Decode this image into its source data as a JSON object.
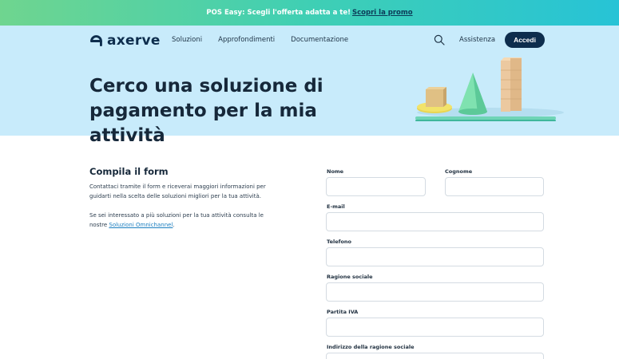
{
  "promo": {
    "text": "POS Easy: Scegli l'offerta adatta a te!",
    "link": "Scopri la promo"
  },
  "header": {
    "logo": "axerve",
    "nav": [
      "Soluzioni",
      "Approfondimenti",
      "Documentazione"
    ],
    "assist": "Assistenza",
    "login": "Accedi"
  },
  "hero": {
    "title": "Cerco una soluzione di pagamento per la mia attività"
  },
  "intro": {
    "title": "Compila il form",
    "p1": "Contattaci tramite il form e riceverai maggiori informazioni per guidarti nella scelta delle soluzioni migliori per la tua attività.",
    "p2_prefix": "Se sei interessato a più soluzioni per la tua attività consulta le nostre ",
    "p2_link": "Soluzioni Omnichannel",
    "p2_suffix": "."
  },
  "form": {
    "nome": "Nome",
    "cognome": "Cognome",
    "email": "E-mail",
    "telefono": "Telefono",
    "ragione": "Ragione sociale",
    "piva": "Partita IVA",
    "indirizzo": "Indirizzo della ragione sociale"
  },
  "colors": {
    "brand": "#0d2d4d",
    "hero_bg": "#c8ebfb",
    "link": "#1c7fc0"
  }
}
